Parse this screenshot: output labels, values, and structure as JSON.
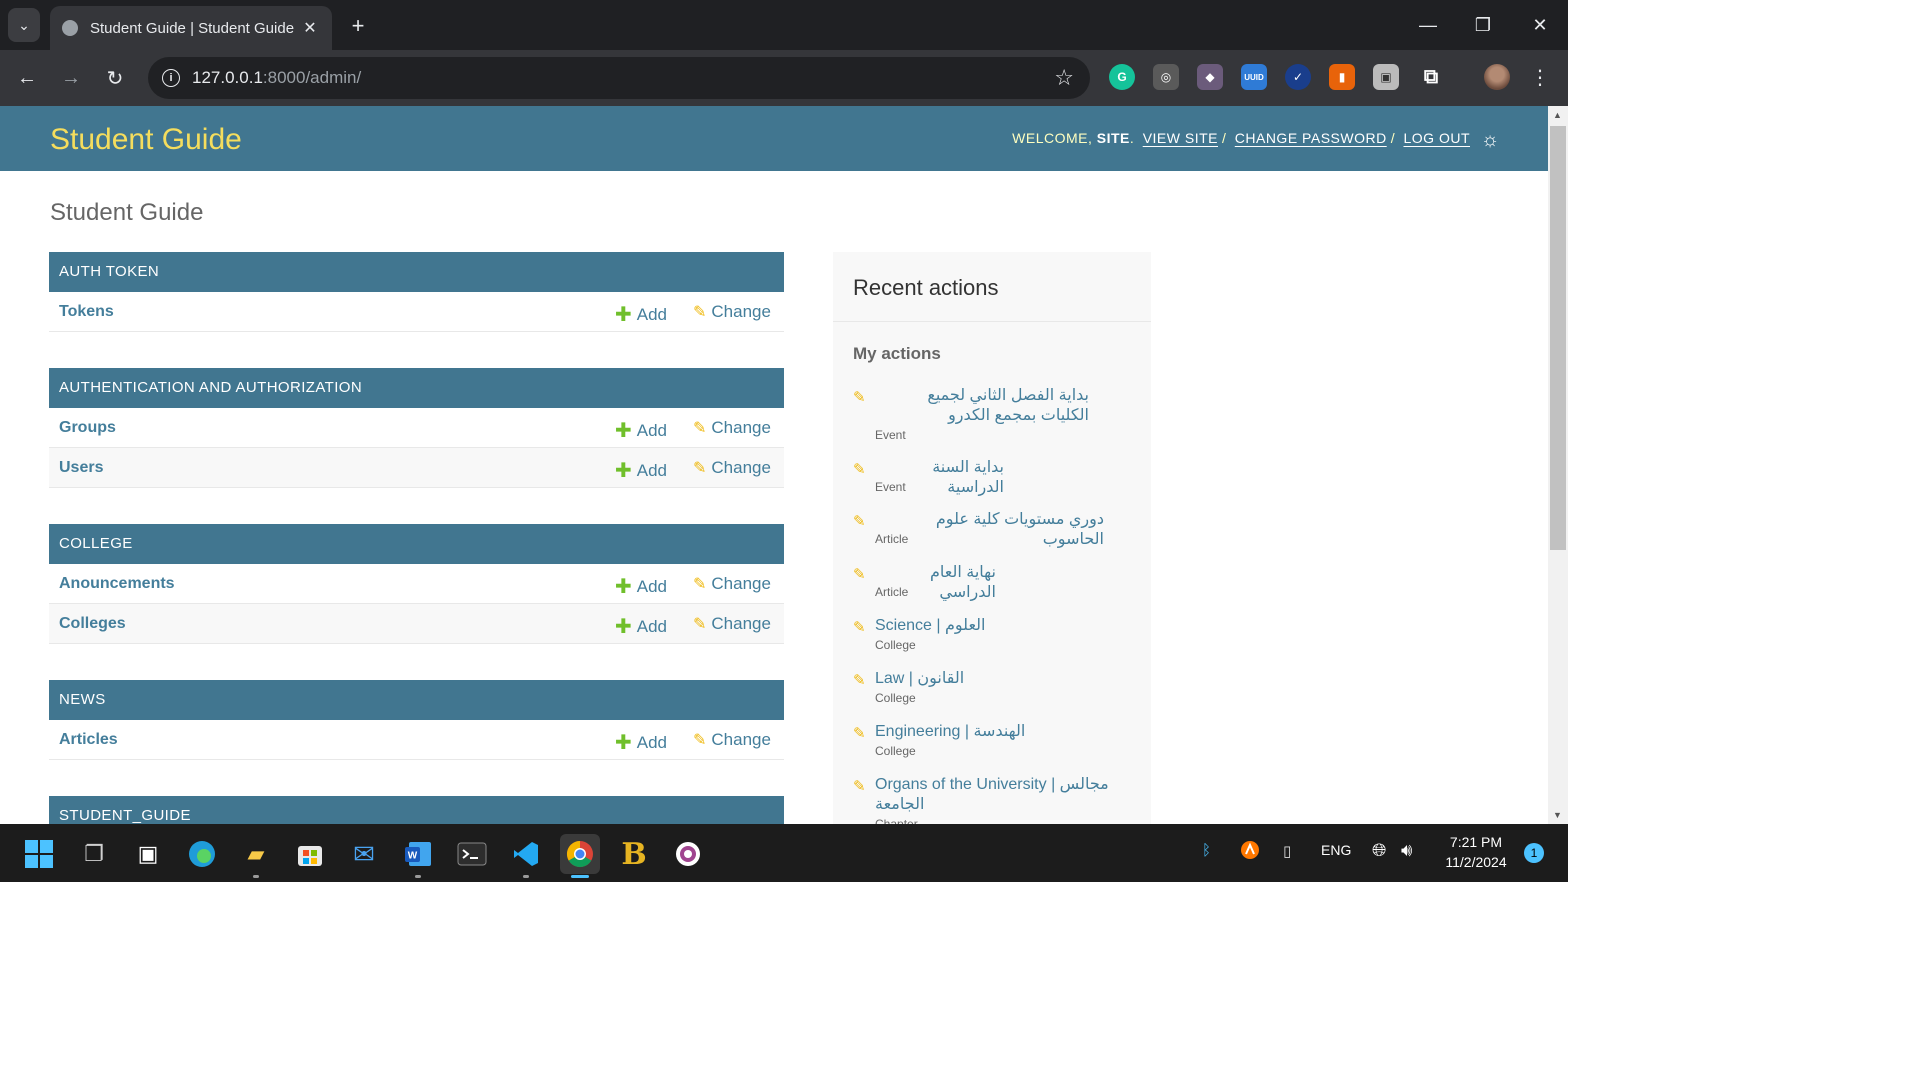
{
  "browser": {
    "tab_title": "Student Guide | Student Guide",
    "url_host": "127.0.0.1",
    "url_path": ":8000/admin/"
  },
  "site": {
    "brand": "Student Guide",
    "welcome": "WELCOME,",
    "user": "SITE",
    "view_site": "VIEW SITE",
    "change_password": "CHANGE PASSWORD",
    "log_out": "LOG OUT",
    "page_title": "Student Guide"
  },
  "labels": {
    "add": "Add",
    "change": "Change"
  },
  "modules": [
    {
      "caption": "AUTH TOKEN",
      "models": [
        "Tokens"
      ]
    },
    {
      "caption": "AUTHENTICATION AND AUTHORIZATION",
      "models": [
        "Groups",
        "Users"
      ]
    },
    {
      "caption": "COLLEGE",
      "models": [
        "Anouncements",
        "Colleges"
      ]
    },
    {
      "caption": "NEWS",
      "models": [
        "Articles"
      ]
    },
    {
      "caption": "STUDENT_GUIDE",
      "models": []
    }
  ],
  "recent": {
    "title": "Recent actions",
    "subtitle": "My actions",
    "items": [
      {
        "title": "بداية الفصل الثاني لجميع الكليات بمجمع الكدرو",
        "type": "Event"
      },
      {
        "title": "بداية السنة الدراسية",
        "type": "Event"
      },
      {
        "title": "دوري مستويات كلية علوم الحاسوب",
        "type": "Article"
      },
      {
        "title": "نهاية العام الدراسي",
        "type": "Article"
      },
      {
        "title": "Science | العلوم",
        "type": "College"
      },
      {
        "title": "Law | القانون",
        "type": "College"
      },
      {
        "title": "Engineering | الهندسة",
        "type": "College"
      },
      {
        "title": "Organs of the University | مجالس الجامعة",
        "type": "Chapter"
      }
    ]
  },
  "taskbar": {
    "lang": "ENG",
    "time": "7:21 PM",
    "date": "11/2/2024",
    "notifications": "1"
  },
  "icons": {
    "accent": "#417690",
    "brand_color": "#f5dd5d",
    "add_color": "#70bf2b",
    "change_color": "#efb80b"
  }
}
